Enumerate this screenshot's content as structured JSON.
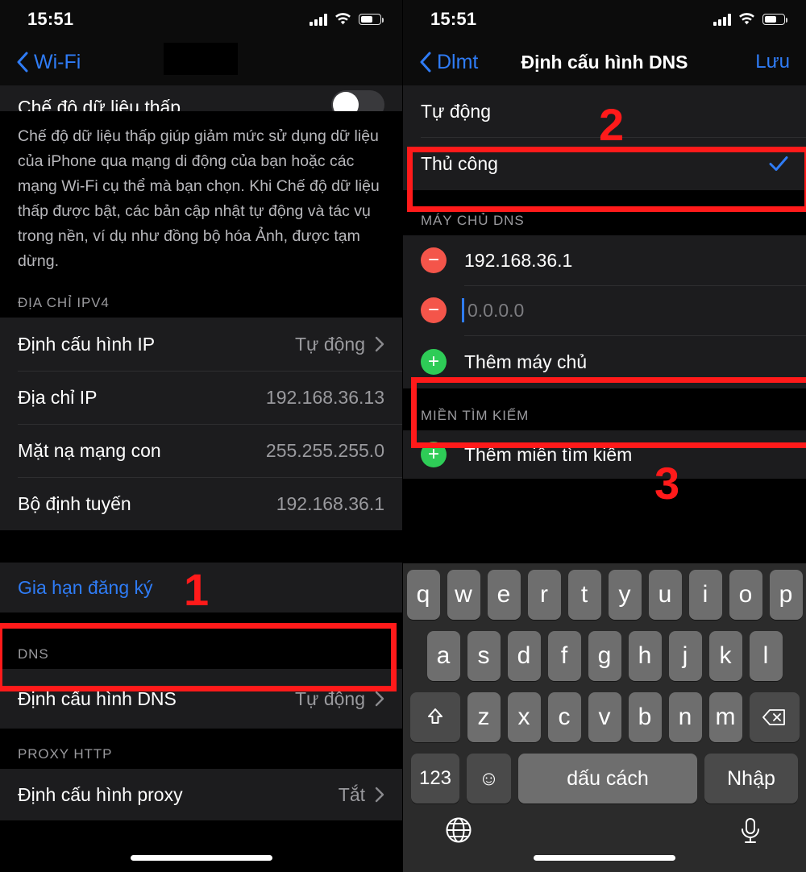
{
  "status_bar": {
    "time": "15:51",
    "cellular_icon": "cellular-bars-icon",
    "wifi_icon": "wifi-icon",
    "battery_icon": "battery-icon"
  },
  "left_screen": {
    "nav": {
      "back_label": "Wi-Fi",
      "back_icon": "chevron-left-icon",
      "title_redacted": ""
    },
    "clipped_row": {
      "label": "Chế độ dữ liệu thấp",
      "toggle_state": "on"
    },
    "footnote": "Chế độ dữ liệu thấp giúp giảm mức sử dụng dữ liệu của iPhone qua mạng di động của bạn hoặc các mạng Wi-Fi cụ thể mà bạn chọn. Khi Chế độ dữ liệu thấp được bật, các bản cập nhật tự động và tác vụ trong nền, ví dụ như đồng bộ hóa Ảnh, được tạm dừng.",
    "ipv4_section": {
      "header": "ĐỊA CHỈ IPV4",
      "rows": [
        {
          "label": "Định cấu hình IP",
          "value": "Tự động",
          "has_chevron": true
        },
        {
          "label": "Địa chỉ IP",
          "value": "192.168.36.13",
          "has_chevron": false
        },
        {
          "label": "Mặt nạ mạng con",
          "value": "255.255.255.0",
          "has_chevron": false
        },
        {
          "label": "Bộ định tuyến",
          "value": "192.168.36.1",
          "has_chevron": false
        }
      ]
    },
    "renew_row": {
      "label": "Gia hạn đăng ký"
    },
    "dns_section": {
      "header": "DNS",
      "row": {
        "label": "Định cấu hình DNS",
        "value": "Tự động",
        "has_chevron": true
      }
    },
    "proxy_section": {
      "header": "PROXY HTTP",
      "row": {
        "label": "Định cấu hình proxy",
        "value": "Tắt",
        "has_chevron": true
      }
    },
    "annotation": {
      "number": "1",
      "color": "#ff1a1a"
    }
  },
  "right_screen": {
    "nav": {
      "back_label": "Dlmt",
      "back_icon": "chevron-left-icon",
      "title": "Định cấu hình DNS",
      "save_label": "Lưu"
    },
    "mode_options": [
      {
        "label": "Tự động",
        "selected": false
      },
      {
        "label": "Thủ công",
        "selected": true,
        "check_icon": "checkmark-icon"
      }
    ],
    "dns_servers": {
      "header": "MÁY CHỦ DNS",
      "entries": [
        {
          "icon": "minus-circle-icon",
          "value": "192.168.36.1",
          "placeholder": "",
          "editing": false
        },
        {
          "icon": "minus-circle-icon",
          "value": "",
          "placeholder": "0.0.0.0",
          "editing": true
        }
      ],
      "add_row": {
        "icon": "plus-circle-icon",
        "label": "Thêm máy chủ"
      }
    },
    "search_domains": {
      "header": "MIỀN TÌM KIẾM",
      "add_row": {
        "icon": "plus-circle-icon",
        "label": "Thêm miền tìm kiếm"
      }
    },
    "annotations": [
      {
        "number": "2",
        "color": "#ff1a1a"
      },
      {
        "number": "3",
        "color": "#ff1a1a"
      }
    ],
    "keyboard": {
      "row1": [
        "q",
        "w",
        "e",
        "r",
        "t",
        "y",
        "u",
        "i",
        "o",
        "p"
      ],
      "row2": [
        "a",
        "s",
        "d",
        "f",
        "g",
        "h",
        "j",
        "k",
        "l"
      ],
      "row3": [
        "z",
        "x",
        "c",
        "v",
        "b",
        "n",
        "m"
      ],
      "shift_icon": "shift-arrow-icon",
      "backspace_icon": "backspace-icon",
      "numeric_label": "123",
      "emoji_icon": "emoji-smiley-icon",
      "space_label": "dấu cách",
      "enter_label": "Nhập",
      "globe_icon": "globe-icon",
      "mic_icon": "microphone-icon"
    }
  }
}
